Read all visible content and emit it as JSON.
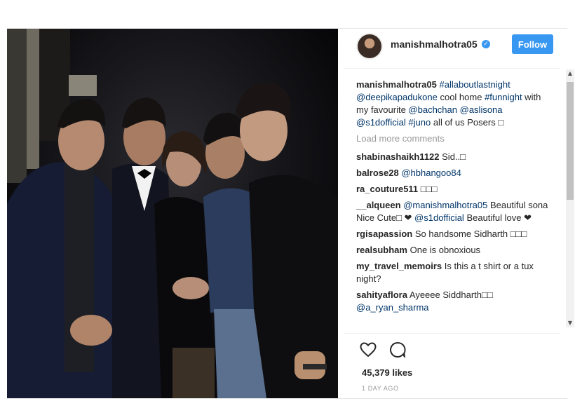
{
  "post": {
    "author": "manishmalhotra05",
    "follow_label": "Follow",
    "verified_glyph": "✓",
    "caption": {
      "user": "manishmalhotra05",
      "parts": [
        {
          "text": "#allaboutlastnight",
          "link": true
        },
        {
          "text": " ",
          "link": false
        },
        {
          "text": "@deepikapadukone",
          "link": true
        },
        {
          "text": " cool home ",
          "link": false
        },
        {
          "text": "#funnight",
          "link": true
        },
        {
          "text": " with my favourite ",
          "link": false
        },
        {
          "text": "@bachchan",
          "link": true
        },
        {
          "text": " ",
          "link": false
        },
        {
          "text": "@aslisona",
          "link": true
        },
        {
          "text": " ",
          "link": false
        },
        {
          "text": "@s1dofficial",
          "link": true
        },
        {
          "text": " ",
          "link": false
        },
        {
          "text": "#juno",
          "link": true
        },
        {
          "text": " all of us Posers □",
          "link": false
        }
      ]
    },
    "load_more": "Load more comments",
    "comments": [
      {
        "user": "shabinashaikh1122",
        "parts": [
          {
            "text": "Sid..□",
            "link": false
          }
        ]
      },
      {
        "user": "balrose28",
        "parts": [
          {
            "text": "@hbhangoo84",
            "link": true
          }
        ]
      },
      {
        "user": "ra_couture511",
        "parts": [
          {
            "text": "□□□",
            "link": false
          }
        ]
      },
      {
        "user": "__alqueen",
        "parts": [
          {
            "text": "@manishmalhotra05",
            "link": true
          },
          {
            "text": " Beautiful sona Nice Cute□ ❤ ",
            "link": false
          },
          {
            "text": "@s1dofficial",
            "link": true
          },
          {
            "text": " Beautiful love ❤",
            "link": false
          }
        ]
      },
      {
        "user": "rgisapassion",
        "parts": [
          {
            "text": "So handsome Sidharth □□□",
            "link": false
          }
        ]
      },
      {
        "user": "realsubham",
        "parts": [
          {
            "text": "One is obnoxious",
            "link": false
          }
        ]
      },
      {
        "user": "my_travel_memoirs",
        "parts": [
          {
            "text": "Is this a t shirt or a tux night?",
            "link": false
          }
        ]
      },
      {
        "user": "sahityaflora",
        "parts": [
          {
            "text": "Ayeeee Siddharth□□ ",
            "link": false
          },
          {
            "text": "@a_ryan_sharma",
            "link": true
          }
        ]
      }
    ],
    "likes": "45,379 likes",
    "timestamp": "1 DAY AGO",
    "icons": {
      "like": "heart-icon",
      "comment": "comment-bubble-icon",
      "verified": "verified-badge-icon",
      "scroll_up": "▲",
      "scroll_down": "▼"
    },
    "colors": {
      "accent": "#3897f0",
      "link": "#003569",
      "text": "#262626",
      "muted": "#999999"
    }
  }
}
